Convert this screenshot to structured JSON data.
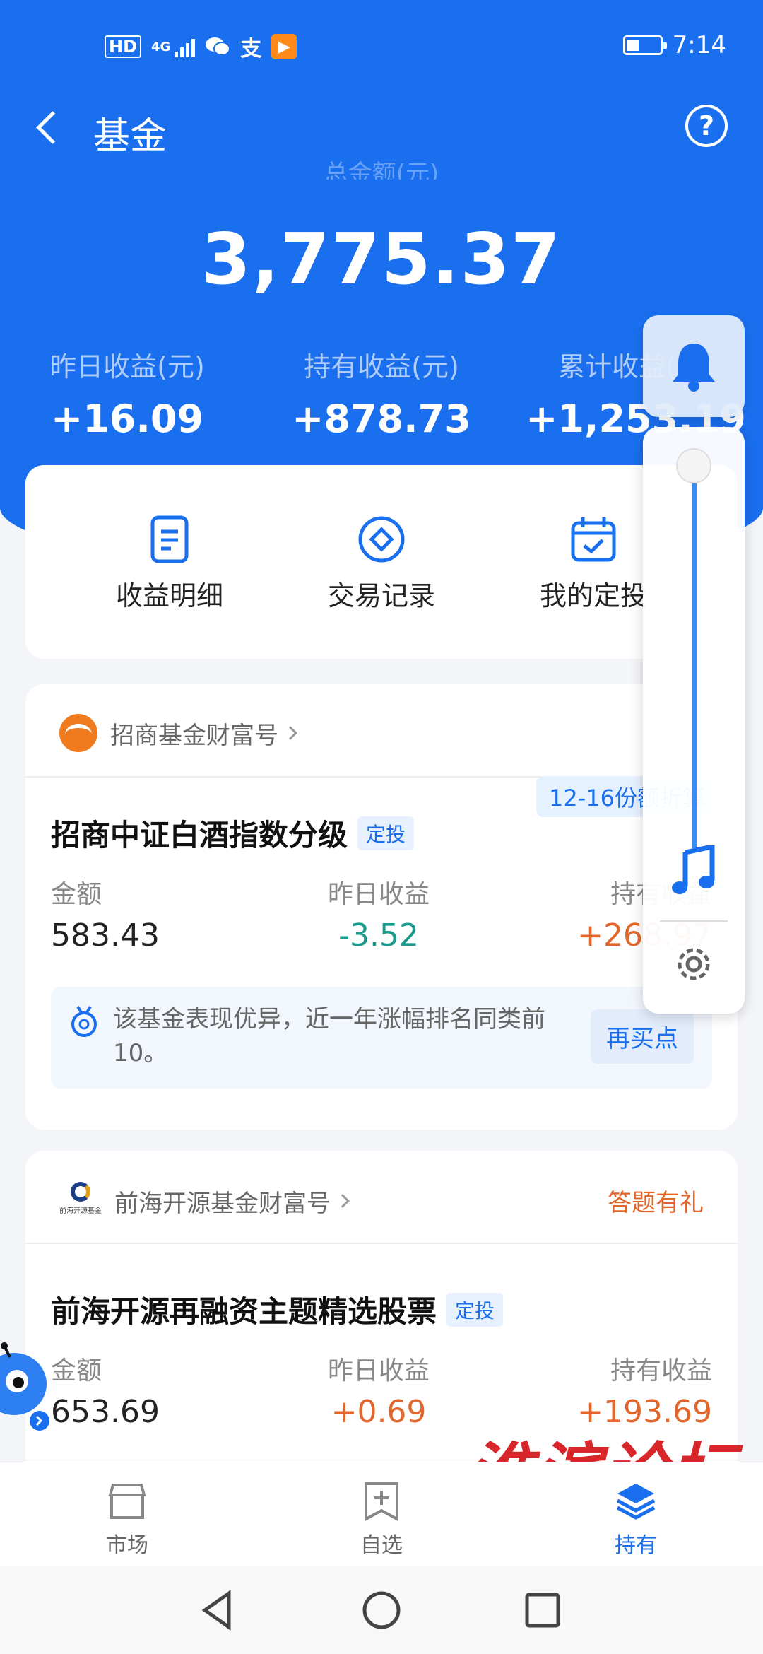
{
  "status_bar": {
    "network": "HD",
    "network_gen": "4G",
    "alipay_glyph": "支",
    "time": "7:14"
  },
  "header": {
    "title": "基金",
    "total_label": "总金额(元)",
    "total_value": "3,775.37",
    "stats": [
      {
        "label": "昨日收益(元)",
        "value": "+16.09"
      },
      {
        "label": "持有收益(元)",
        "value": "+878.73"
      },
      {
        "label": "累计收益(元)",
        "value": "+1,253.19"
      }
    ]
  },
  "quick_actions": [
    {
      "label": "收益明细",
      "icon": "document-icon"
    },
    {
      "label": "交易记录",
      "icon": "diamond-circle-icon"
    },
    {
      "label": "我的定投",
      "icon": "calendar-check-icon"
    }
  ],
  "funds": [
    {
      "company": "招商基金财富号",
      "notice": "12-16份额折算",
      "name": "招商中证白酒指数分级",
      "tag": "定投",
      "metrics": [
        {
          "label": "金额",
          "value": "583.43"
        },
        {
          "label": "昨日收益",
          "value": "-3.52"
        },
        {
          "label": "持有收益",
          "value": "+268.97"
        }
      ],
      "tip": "该基金表现优异，近一年涨幅排名同类前10。",
      "tip_button": "再买点"
    },
    {
      "company": "前海开源基金财富号",
      "promo": "答题有礼",
      "name": "前海开源再融资主题精选股票",
      "tag": "定投",
      "metrics": [
        {
          "label": "金额",
          "value": "653.69"
        },
        {
          "label": "昨日收益",
          "value": "+0.69"
        },
        {
          "label": "持有收益",
          "value": "+193.69"
        }
      ]
    }
  ],
  "tabs": [
    {
      "label": "市场",
      "icon": "market-icon",
      "active": false
    },
    {
      "label": "自选",
      "icon": "watchlist-add-icon",
      "active": false
    },
    {
      "label": "持有",
      "icon": "holdings-layers-icon",
      "active": true
    }
  ],
  "watermark": "淮滨论坛",
  "colors": {
    "primary": "#1a6fef",
    "gain": "#e2662b",
    "loss": "#1a9a8a"
  }
}
